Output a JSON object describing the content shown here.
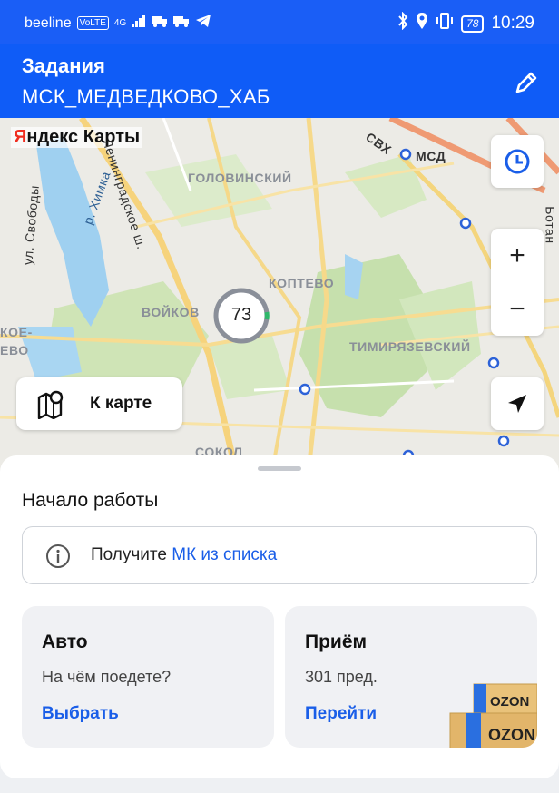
{
  "status_bar": {
    "carrier": "beeline",
    "volte": "VoLTE",
    "network": "4G",
    "battery": "78",
    "time": "10:29"
  },
  "header": {
    "title": "Задания",
    "subtitle": "МСК_МЕДВЕДКОВО_ХАБ",
    "edit_icon": "pencil-icon"
  },
  "map": {
    "provider": "Яндекс Карты",
    "labels": {
      "golovinsky": "ГОЛОВИНСКИЙ",
      "koptevo": "КОПТЕВО",
      "voykov": "ВОЙКОВ",
      "timiryazevsky": "ТИМИРЯЗЕВСКИЙ",
      "sokol": "СОКОЛ",
      "leningradskoe": "Ленинградское ш.",
      "himka": "р. Химка",
      "svobody": "ул. Свободы",
      "svh": "СВХ",
      "msd": "МСД",
      "botan": "Ботан",
      "left_a": "КОЕ-",
      "left_b": "ЕВО"
    },
    "cluster_count": "73",
    "to_map_label": "К карте",
    "zoom_in": "+",
    "zoom_out": "−"
  },
  "sheet": {
    "section_title": "Начало работы",
    "notice_prefix": "Получите ",
    "notice_link": "МК из списка",
    "cards": [
      {
        "title": "Авто",
        "subtitle": "На чём поедете?",
        "action": "Выбрать"
      },
      {
        "title": "Приём",
        "subtitle": "301 пред.",
        "action": "Перейти"
      }
    ],
    "brand": "OZON"
  },
  "colors": {
    "primary": "#0f5cf7",
    "link": "#1a5ee8",
    "card_bg": "#f0f1f4"
  }
}
